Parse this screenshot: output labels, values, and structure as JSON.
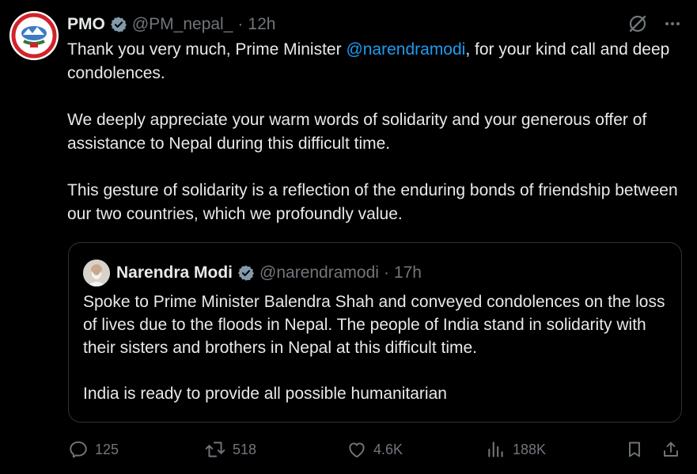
{
  "tweet": {
    "display_name": "PMO",
    "handle": "@PM_nepal_",
    "separator": "·",
    "time": "12h",
    "text_p1_before": "Thank you very much, Prime Minister ",
    "text_p1_mention": "@narendramodi",
    "text_p1_after": ", for your kind call and deep condolences.",
    "text_p2": "We deeply appreciate your warm words of solidarity and your generous offer of assistance to Nepal during this difficult time.",
    "text_p3": "This gesture of solidarity is a reflection of the enduring bonds of friendship between our two countries, which we profoundly value."
  },
  "quote": {
    "display_name": "Narendra Modi",
    "handle": "@narendramodi",
    "separator": "·",
    "time": "17h",
    "text_p1": "Spoke to Prime Minister Balendra Shah and conveyed condolences on the loss of lives due to the floods in Nepal. The people of India stand in solidarity with their sisters and brothers in Nepal at this difficult time.",
    "text_p2": "India is ready to provide all possible humanitarian"
  },
  "actions": {
    "replies": "125",
    "reposts": "518",
    "likes": "4.6K",
    "views": "188K"
  },
  "icons": {
    "top": [
      "grok-icon",
      "more-icon"
    ],
    "bottom": [
      "reply-icon",
      "repost-icon",
      "like-icon",
      "views-icon",
      "bookmark-icon",
      "share-icon"
    ]
  },
  "colors": {
    "background": "#000000",
    "text": "#e7e9ea",
    "muted": "#71767b",
    "link": "#1d9bf0",
    "verified_badge": "#829aab",
    "border": "#2f3336"
  }
}
